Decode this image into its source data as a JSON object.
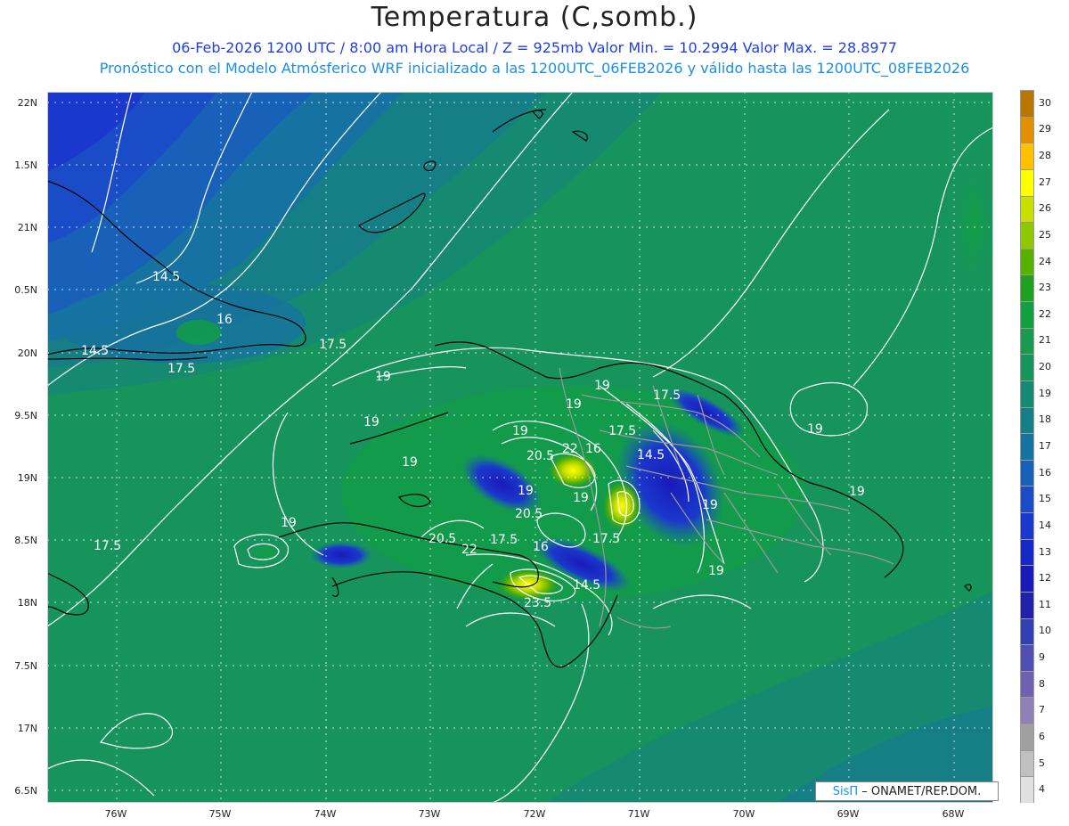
{
  "header": {
    "title": "Temperatura (C,somb.)",
    "line1": "06-Feb-2026  1200 UTC / 8:00 am Hora Local / Z = 925mb    Valor Min. = 10.2994  Valor Max. = 28.8977",
    "line2": "Pronóstico con el Modelo Atmósferico WRF inicializado a las 1200UTC_06FEB2026 y válido hasta las  1200UTC_08FEB2026"
  },
  "axes": {
    "lat_labels": [
      "22N",
      "1.5N",
      "21N",
      "0.5N",
      "20N",
      "9.5N",
      "19N",
      "8.5N",
      "18N",
      "7.5N",
      "17N",
      "6.5N"
    ],
    "lon_labels": [
      "76W",
      "75W",
      "74W",
      "73W",
      "72W",
      "71W",
      "70W",
      "69W",
      "68W"
    ]
  },
  "colorbar": {
    "labels": [
      "30",
      "29",
      "28",
      "27",
      "26",
      "25",
      "24",
      "23",
      "22",
      "21",
      "20",
      "19",
      "18",
      "17",
      "16",
      "15",
      "14",
      "13",
      "12",
      "11",
      "10",
      "9",
      "8",
      "7",
      "6",
      "5",
      "4"
    ],
    "colors": [
      "#b87800",
      "#e09000",
      "#ffc000",
      "#ffff00",
      "#c8e000",
      "#90c800",
      "#58b000",
      "#20a020",
      "#10a040",
      "#1a9a50",
      "#17945c",
      "#168a70",
      "#157f85",
      "#1672a0",
      "#1860b8",
      "#1a4cc8",
      "#1a38cc",
      "#1828c4",
      "#1a1ab8",
      "#2020a8",
      "#3040b0",
      "#5050b0",
      "#7060b0",
      "#9080b8",
      "#a0a0a0",
      "#c0c0c0",
      "#e0e0e0"
    ]
  },
  "contour_labels": [
    "14.5",
    "16",
    "14.5",
    "17.5",
    "17.5",
    "19",
    "19",
    "19",
    "19",
    "19",
    "19",
    "20.5",
    "22",
    "16",
    "14.5",
    "17.5",
    "19",
    "17.5",
    "19",
    "19",
    "19",
    "20.5",
    "17.5",
    "19",
    "20.5",
    "22",
    "17.5",
    "16",
    "14.5",
    "23.5",
    "17.5",
    "19",
    "19"
  ],
  "credit": {
    "sis": "SisΠ",
    "text": "– ONAMET/REP.DOM."
  }
}
